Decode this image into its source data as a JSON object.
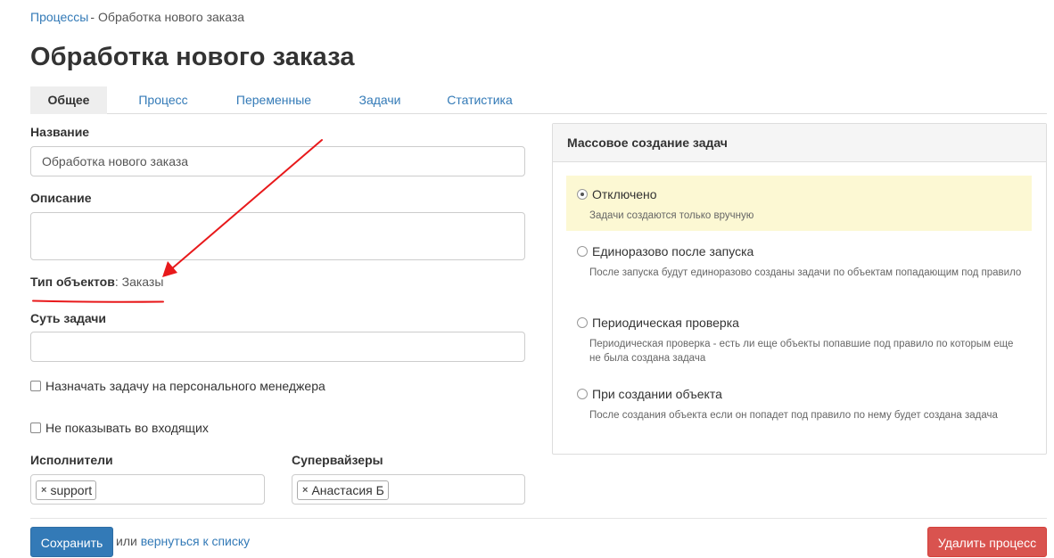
{
  "breadcrumb": {
    "parent": "Процессы",
    "separator": "-",
    "current": "Обработка нового заказа"
  },
  "page": {
    "title": "Обработка нового заказа"
  },
  "tabs": [
    {
      "label": "Общее",
      "active": true
    },
    {
      "label": "Процесс",
      "active": false
    },
    {
      "label": "Переменные",
      "active": false
    },
    {
      "label": "Задачи",
      "active": false
    },
    {
      "label": "Статистика",
      "active": false
    }
  ],
  "form": {
    "name_label": "Название",
    "name_value": "Обработка нового заказа",
    "description_label": "Описание",
    "description_value": "",
    "object_type_label": "Тип объектов",
    "object_type_value": ": Заказы",
    "task_essence_label": "Суть задачи",
    "task_essence_value": "",
    "assign_manager_label": "Назначать задачу на персонального менеджера",
    "hide_inbox_label": "Не показывать во входящих",
    "executors_label": "Исполнители",
    "executors_tags": [
      "support"
    ],
    "supervisors_label": "Супервайзеры",
    "supervisors_tags": [
      "Анастасия Б"
    ]
  },
  "footer": {
    "save_label": "Сохранить",
    "or_text": "или",
    "back_link": "вернуться к списку",
    "delete_label": "Удалить процесс"
  },
  "mass_panel": {
    "title": "Массовое создание задач",
    "options": [
      {
        "label": "Отключено",
        "help": "Задачи создаются только вручную",
        "selected": true
      },
      {
        "label": "Единоразово после запуска",
        "help": "После запуска будут единоразово созданы задачи по объектам попадающим под правило",
        "selected": false
      },
      {
        "label": "Периодическая проверка",
        "help": "Периодическая проверка - есть ли еще объекты попавшие под правило по которым еще не была создана задача",
        "selected": false
      },
      {
        "label": "При создании объекта",
        "help": "После создания объекта если он попадет под правило по нему будет создана задача",
        "selected": false
      }
    ]
  },
  "colors": {
    "link": "#337ab7",
    "primary_button": "#337ab7",
    "danger_button": "#d9534f",
    "highlight": "#fcf8d3",
    "annotation": "#e8191b"
  }
}
